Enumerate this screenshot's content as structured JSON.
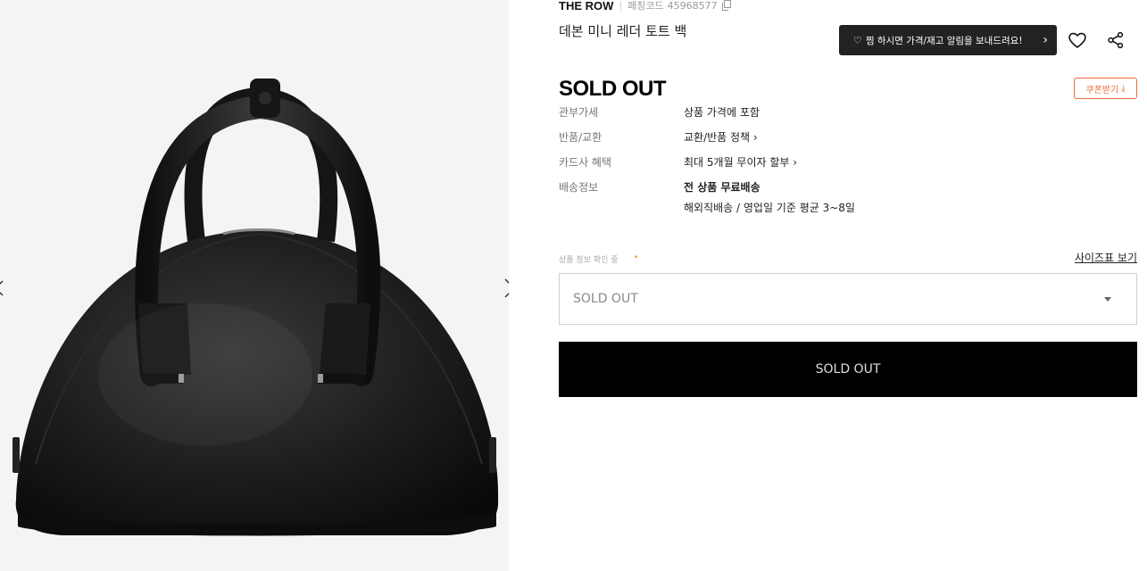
{
  "product": {
    "brand": "THE ROW",
    "code_label": "페칭코드",
    "code": "45968577",
    "name": "데본 미니 레더 토트 백",
    "price_status": "SOLD OUT"
  },
  "alert_tooltip": {
    "heart": "♡",
    "text": "찜 하시면 가격/재고 알림을 보내드려요!",
    "chevron": "›"
  },
  "icons": {
    "wish": "heart-outline-icon",
    "share": "share-icon",
    "copy": "copy-icon",
    "download": "download-icon"
  },
  "coupon": {
    "label": "쿠폰받기",
    "icon": "⤓"
  },
  "details": [
    {
      "label": "관부가세",
      "value": "상품 가격에 포함"
    },
    {
      "label": "반품/교환",
      "value": "교환/반품 정책 ›"
    },
    {
      "label": "카드사 혜택",
      "value": "최대 5개월 무이자 할부 ›"
    },
    {
      "label": "배송정보",
      "value": "전 상품 무료배송",
      "sub": "해외직배송 / 영업일 기준 평균 3~8일"
    }
  ],
  "options": {
    "status": "상품 정보 확인 중",
    "status_dot": "•",
    "size_chart": "사이즈표 보기",
    "selected": "SOLD OUT"
  },
  "cta": {
    "label": "SOLD OUT"
  },
  "colors": {
    "accent": "#f06b3a",
    "cta_bg": "#000000",
    "tooltip_bg": "#222222"
  }
}
